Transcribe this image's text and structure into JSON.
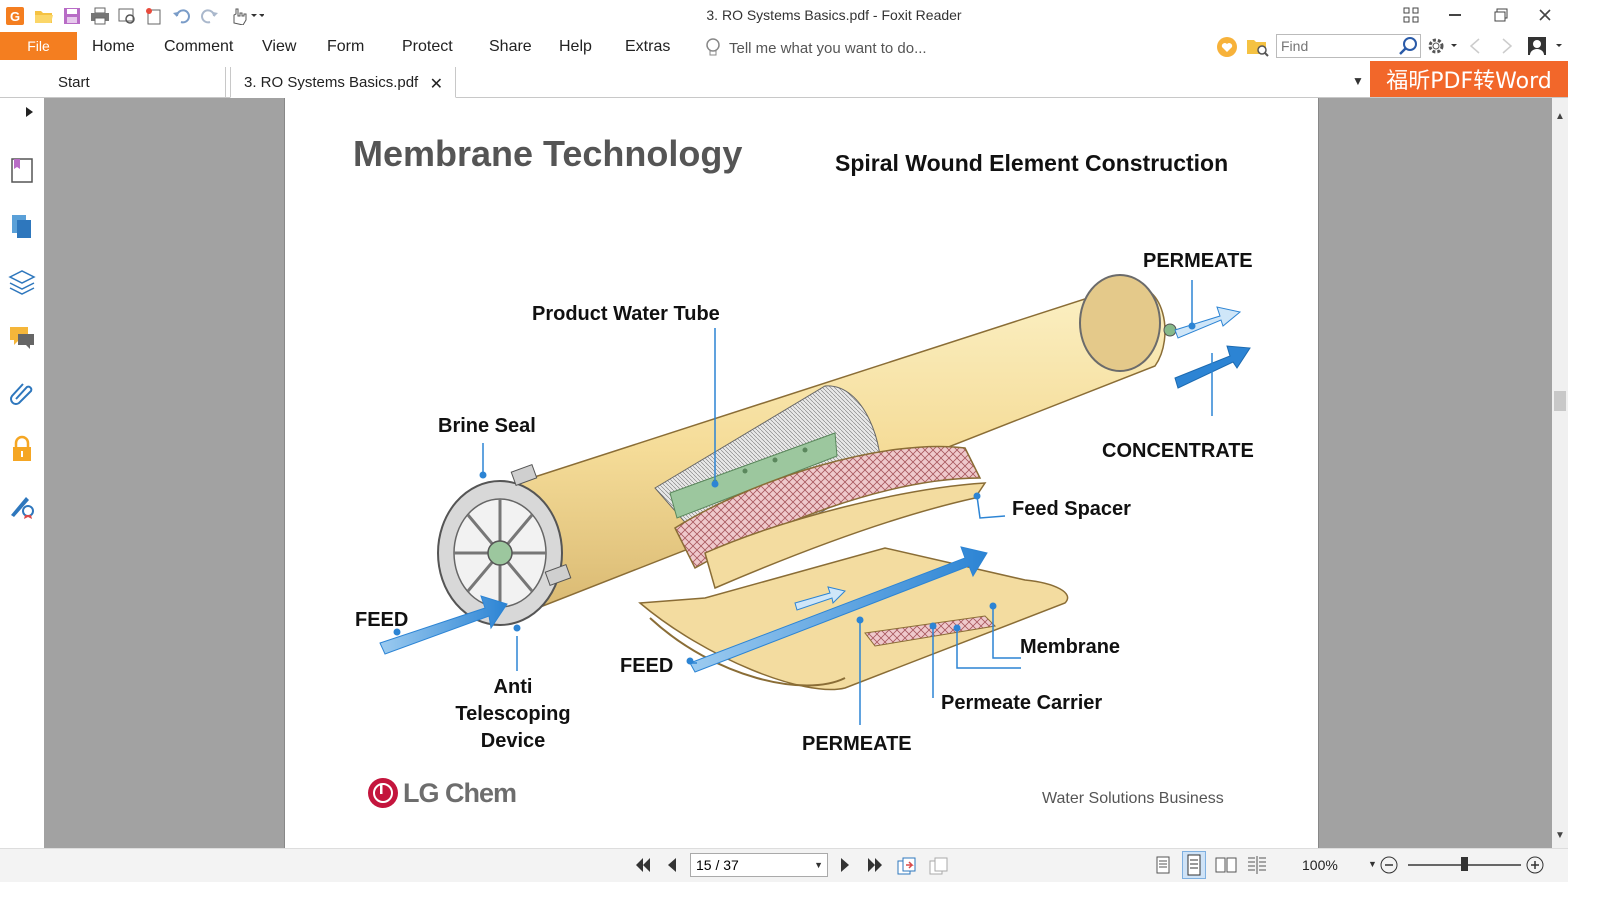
{
  "window": {
    "title": "3. RO Systems Basics.pdf - Foxit Reader"
  },
  "menu": {
    "file": "File",
    "items": [
      "Home",
      "Comment",
      "View",
      "Form",
      "Protect",
      "Share",
      "Help",
      "Extras"
    ],
    "tell_me": "Tell me what you want to do...",
    "find_placeholder": "Find"
  },
  "tabs": {
    "start": "Start",
    "active": "3. RO Systems Basics.pdf"
  },
  "promo": {
    "label": "福昕PDF转Word"
  },
  "slide": {
    "title": "Membrane Technology",
    "subtitle": "Spiral Wound Element Construction",
    "labels": {
      "permeate_top": "PERMEATE",
      "product_water_tube": "Product Water Tube",
      "brine_seal": "Brine Seal",
      "concentrate": "CONCENTRATE",
      "feed_spacer": "Feed Spacer",
      "feed_left": "FEED",
      "feed_middle": "FEED",
      "membrane": "Membrane",
      "permeate_carrier": "Permeate Carrier",
      "anti_line1": "Anti",
      "anti_line2": "Telescoping",
      "anti_line3": "Device",
      "permeate_bottom": "PERMEATE"
    },
    "logo_text": "LG Chem",
    "footer": "Water Solutions Business"
  },
  "statusbar": {
    "page": "15 / 37",
    "zoom": "100%",
    "zoom_level": 0.5
  },
  "colors": {
    "accent": "#f47e20",
    "promo": "#f2672a",
    "canvas": "#a2a2a2",
    "cylinder": "#f7e4a4",
    "mesh": "#d9a0a4",
    "arrow": "#3a92d8",
    "tube": "#86b98a"
  }
}
